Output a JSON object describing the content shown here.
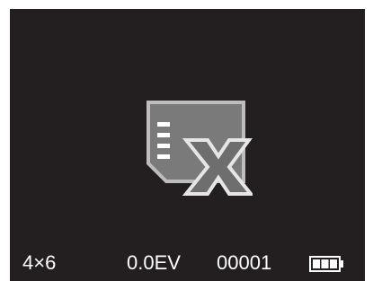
{
  "screen": {
    "background": "#231f20",
    "center_icon": "card-error-icon"
  },
  "status_bar": {
    "print_size": "4×6",
    "exposure": "0.0EV",
    "frame_counter": "00001",
    "battery_icon": "battery-full-icon",
    "battery_level": 1.0,
    "text_color": "#ffffff"
  }
}
